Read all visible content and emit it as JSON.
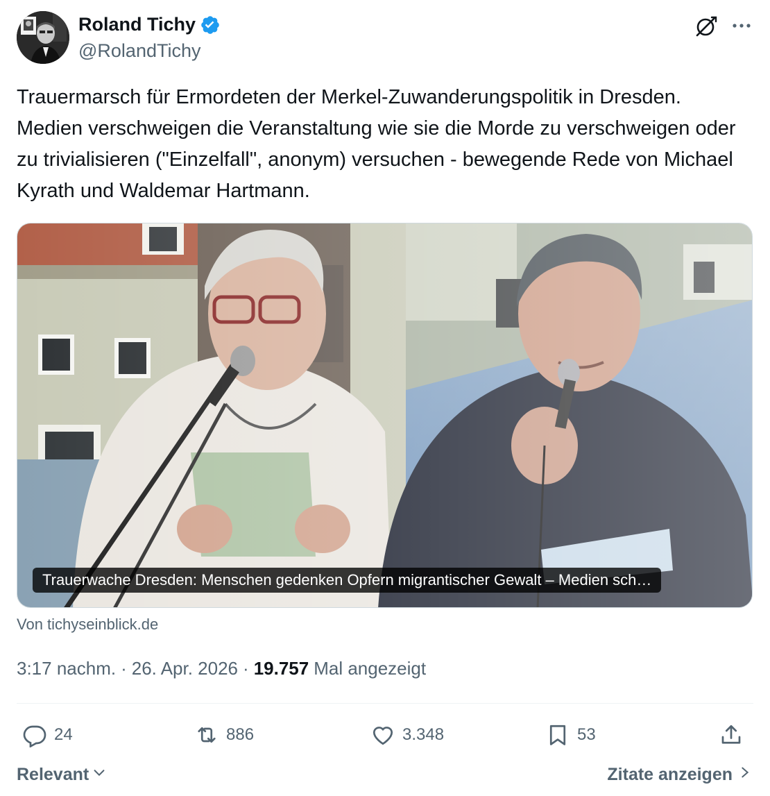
{
  "author": {
    "name": "Roland Tichy",
    "handle": "@RolandTichy",
    "verified_icon": "verified-badge-icon",
    "verified_color": "#1d9bf0"
  },
  "header_icons": {
    "grok": "grok-icon",
    "more": "more-icon"
  },
  "tweet": {
    "text": "Trauermarsch für Ermordeten der Merkel-Zuwanderungspolitik in Dresden. Medien verschweigen die Veranstaltung wie sie die Morde zu verschweigen oder zu trivialisieren (\"Einzelfall\", anonym) versuchen - bewegende Rede von Michael Kyrath und Waldemar Hartmann."
  },
  "media": {
    "caption": "Trauerwache Dresden: Menschen gedenken Opfern migrantischer Gewalt – Medien sch…",
    "source": "Von tichyseinblick.de"
  },
  "meta": {
    "time": "3:17 nachm.",
    "sep1": "·",
    "date": "26. Apr. 2026",
    "sep2": "·",
    "views_count": "19.757",
    "views_label": "Mal angezeigt"
  },
  "actions": {
    "replies": "24",
    "reposts": "886",
    "likes": "3.348",
    "bookmarks": "53"
  },
  "footer": {
    "sort_label": "Relevant",
    "quotes_label": "Zitate anzeigen"
  },
  "colors": {
    "text_primary": "#0f1419",
    "text_secondary": "#536471",
    "accent": "#1d9bf0",
    "divider": "#eff3f4"
  }
}
